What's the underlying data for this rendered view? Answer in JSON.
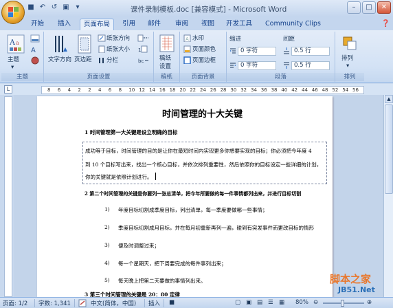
{
  "window": {
    "title": "课件录制模板.doc [兼容模式] - Microsoft Word"
  },
  "quick_access": {
    "save_icon": "save-icon",
    "undo_icon": "undo-icon",
    "redo_icon": "redo-icon"
  },
  "tabs": [
    {
      "label": "开始"
    },
    {
      "label": "插入"
    },
    {
      "label": "页面布局",
      "active": true
    },
    {
      "label": "引用"
    },
    {
      "label": "邮件"
    },
    {
      "label": "审阅"
    },
    {
      "label": "视图"
    },
    {
      "label": "开发工具"
    },
    {
      "label": "Community Clips"
    }
  ],
  "ribbon": {
    "themes": {
      "group_label": "主题",
      "button": "主题"
    },
    "page_setup": {
      "group_label": "页面设置",
      "text_direction": "文字方向",
      "margins": "页边距",
      "orientation": "纸张方向",
      "size": "纸张大小",
      "columns": "分栏"
    },
    "draft": {
      "group_label": "稿纸",
      "button_line1": "稿纸",
      "button_line2": "设置"
    },
    "page_background": {
      "group_label": "页面背景",
      "watermark": "水印",
      "page_color": "页面颜色",
      "page_borders": "页面边框"
    },
    "paragraph": {
      "group_label": "段落",
      "indent_label": "缩进",
      "spacing_label": "间距",
      "indent_left": "0 字符",
      "indent_right": "0 字符",
      "spacing_before": "0.5 行",
      "spacing_after": "0.5 行"
    },
    "arrange": {
      "group_label": "排列",
      "button": "排列"
    }
  },
  "ruler": {
    "numbers": [
      "8",
      "6",
      "4",
      "2",
      "2",
      "4",
      "6",
      "8",
      "10",
      "12",
      "14",
      "16",
      "18",
      "20",
      "22",
      "24",
      "26",
      "28",
      "30",
      "32",
      "34",
      "36",
      "38",
      "40",
      "42",
      "44",
      "46",
      "48",
      "52",
      "54",
      "56"
    ]
  },
  "document": {
    "title": "时间管理的十大关键",
    "heading1": "1   时间管理第一大关键是设立明确的目标",
    "para1_line1": "成功等于目标，时间管理的目的是让你在最短时间内实现更多你想要实现的目标；你必须把今年度 4",
    "para1_line2": "到 10 个目标写出来，找出一个核心目标，并依次排列重要性，然后依照你的目标设定一些详细的计划，",
    "para1_line3": "你的关键就是依照计划进行。",
    "heading2": "2   第二个时间管理的关键是你要列一张总清单，把今年所要做的每一件事情都列出来，并进行目标切割",
    "list": [
      {
        "num": "1)",
        "text": "年度目标切割成季度目标，列出清单，每一季度要做哪一些事情；"
      },
      {
        "num": "2)",
        "text": "季度目标切割成月目标，并在每月初重新再列一遍，碰到有突发事件而更改目标的情形"
      },
      {
        "num": "3)",
        "text": "便及时调整过来；"
      },
      {
        "num": "4)",
        "text": "每一个星期天，把下周要完成的每件事列出来；"
      },
      {
        "num": "5)",
        "text": "每天晚上把第二天要做的事情列出来。"
      }
    ],
    "heading3": "3   第三个时间管理的关键是 20：80 定律"
  },
  "status_bar": {
    "page": "页面: 1/2",
    "words": "字数: 1,341",
    "language": "中文(简体，中国)",
    "insert": "插入",
    "zoom": "80%"
  },
  "watermark": {
    "line1": "脚本之家",
    "line2": "JB51.Net"
  }
}
